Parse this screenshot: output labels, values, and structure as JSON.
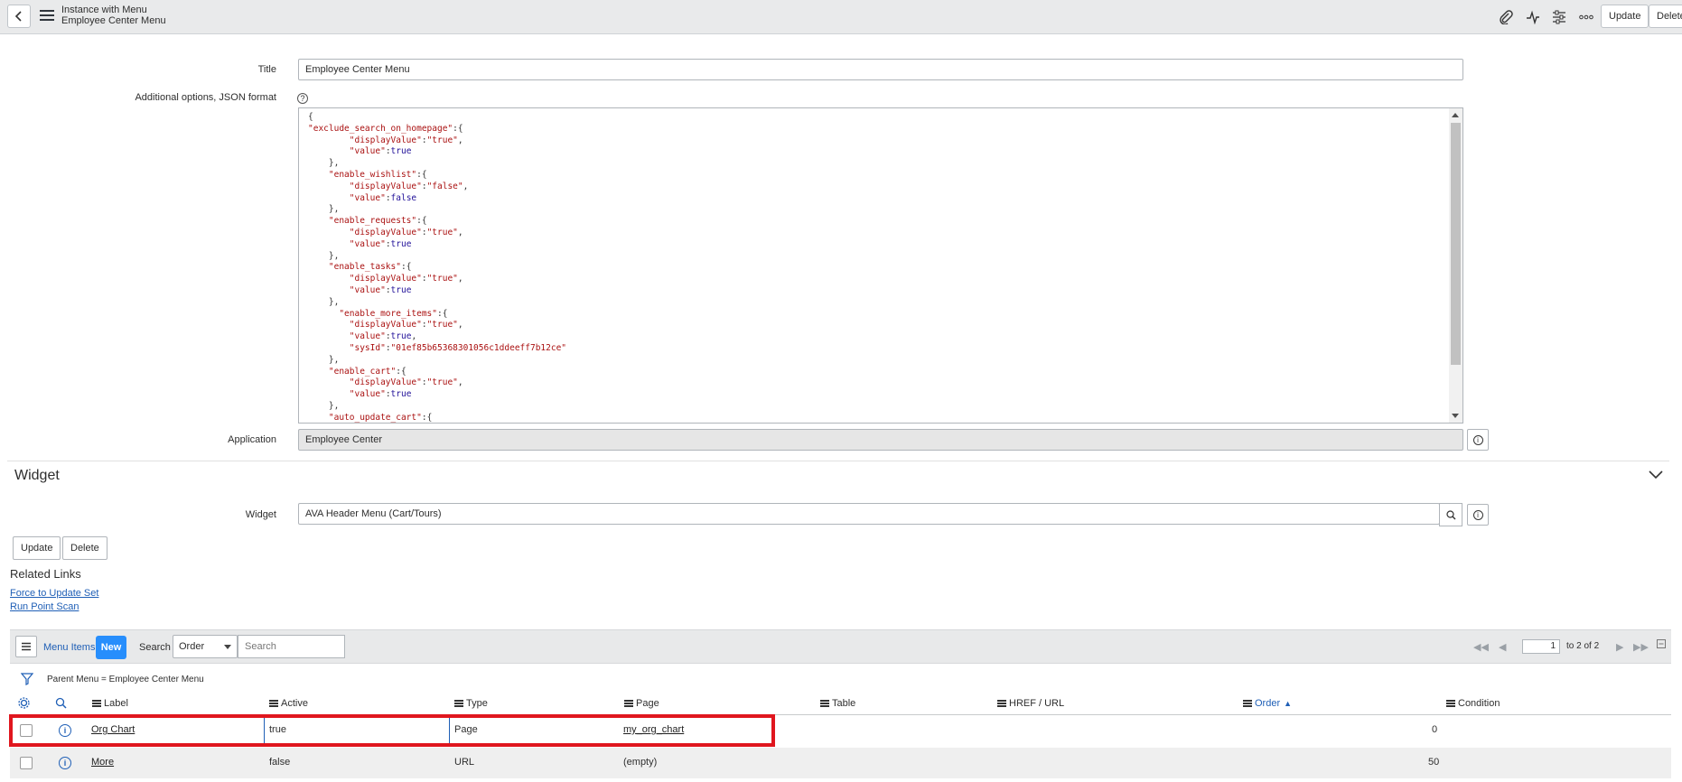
{
  "header": {
    "title_line1": "Instance with Menu",
    "title_line2": "Employee Center Menu",
    "update_label": "Update",
    "delete_label": "Delete"
  },
  "form": {
    "title_label": "Title",
    "title_value": "Employee Center Menu",
    "options_label": "Additional options, JSON format",
    "json_lines": [
      "{",
      "\"exclude_search_on_homepage\":{",
      "        \"displayValue\":\"true\",",
      "        \"value\":true",
      "    },",
      "    \"enable_wishlist\":{",
      "        \"displayValue\":\"false\",",
      "        \"value\":false",
      "    },",
      "    \"enable_requests\":{",
      "        \"displayValue\":\"true\",",
      "        \"value\":true",
      "    },",
      "    \"enable_tasks\":{",
      "        \"displayValue\":\"true\",",
      "        \"value\":true",
      "    },",
      "      \"enable_more_items\":{",
      "        \"displayValue\":\"true\",",
      "        \"value\":true,",
      "        \"sysId\":\"01ef85b65368301056c1ddeeff7b12ce\"",
      "    },",
      "    \"enable_cart\":{",
      "        \"displayValue\":\"true\",",
      "        \"value\":true",
      "    },",
      "    \"auto_update_cart\":{"
    ],
    "application_label": "Application",
    "application_value": "Employee Center"
  },
  "widget_section": {
    "title": "Widget",
    "widget_label": "Widget",
    "widget_value": "AVA Header Menu (Cart/Tours)",
    "update_label": "Update",
    "delete_label": "Delete"
  },
  "related_links": {
    "title": "Related Links",
    "links": [
      "Force to Update Set",
      "Run Point Scan"
    ]
  },
  "list": {
    "title": "Menu Items",
    "new_label": "New",
    "search_label": "Search",
    "search_field": "Order",
    "search_placeholder": "Search",
    "page_value": "1",
    "page_of": "to 2 of 2",
    "filter": "Parent Menu = Employee Center Menu",
    "columns": [
      "Label",
      "Active",
      "Type",
      "Page",
      "Table",
      "HREF / URL",
      "Order",
      "Condition"
    ],
    "rows": [
      {
        "label": "Org Chart",
        "active": "true",
        "type": "Page",
        "page": "my_org_chart",
        "table": "",
        "href": "",
        "order": "0",
        "condition": ""
      },
      {
        "label": "More",
        "active": "false",
        "type": "URL",
        "page": "(empty)",
        "table": "",
        "href": "",
        "order": "50",
        "condition": ""
      }
    ]
  },
  "colors": {
    "accent": "#278efc",
    "link": "#1f5fb6",
    "highlight": "#e0161e",
    "header_bg": "#e9eaeb"
  }
}
